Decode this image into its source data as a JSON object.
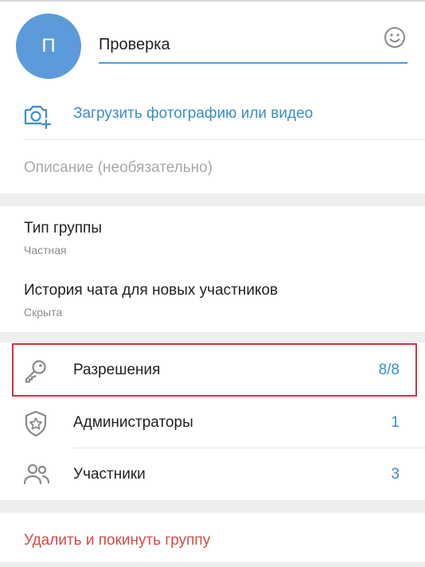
{
  "profile": {
    "avatar_letter": "П",
    "group_name": "Проверка",
    "emoji_icon": "smiley-icon"
  },
  "upload": {
    "label": "Загрузить фотографию или видео",
    "icon": "camera-add-icon"
  },
  "description": {
    "placeholder": "Описание (необязательно)"
  },
  "group_type": {
    "title": "Тип группы",
    "value": "Частная"
  },
  "chat_history": {
    "title": "История чата для новых участников",
    "value": "Скрыта"
  },
  "settings": [
    {
      "label": "Разрешения",
      "value": "8/8",
      "icon": "key-icon"
    },
    {
      "label": "Администраторы",
      "value": "1",
      "icon": "shield-star-icon"
    },
    {
      "label": "Участники",
      "value": "3",
      "icon": "users-icon"
    }
  ],
  "delete_label": "Удалить и покинуть группу",
  "colors": {
    "accent": "#3a8fc7",
    "avatar": "#5b9bd9",
    "danger": "#d74b46",
    "highlight_border": "#d3323b"
  }
}
